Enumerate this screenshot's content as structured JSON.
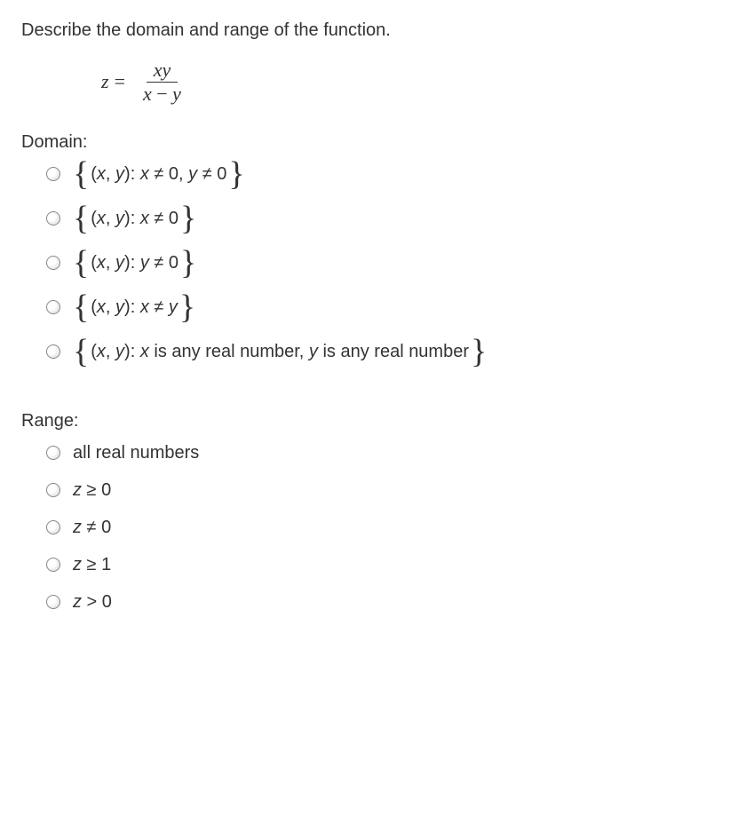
{
  "question": "Describe the domain and range of the function.",
  "equation": {
    "lhs_var": "z",
    "numerator": "xy",
    "denominator_left": "x",
    "denominator_right": "y"
  },
  "sections": {
    "domain_label": "Domain:",
    "range_label": "Range:"
  },
  "domain_options": [
    {
      "body_html": "(<span class='mathvar'>x</span>, <span class='mathvar'>y</span>): <span class='mathvar'>x</span> ≠ 0, <span class='mathvar'>y</span> ≠ 0"
    },
    {
      "body_html": "(<span class='mathvar'>x</span>, <span class='mathvar'>y</span>): <span class='mathvar'>x</span> ≠ 0"
    },
    {
      "body_html": "(<span class='mathvar'>x</span>, <span class='mathvar'>y</span>): <span class='mathvar'>y</span> ≠ 0"
    },
    {
      "body_html": "(<span class='mathvar'>x</span>, <span class='mathvar'>y</span>): <span class='mathvar'>x</span> ≠ <span class='mathvar'>y</span>"
    },
    {
      "body_html": "(<span class='mathvar'>x</span>, <span class='mathvar'>y</span>): <span class='mathvar'>x</span> is any real number, <span class='mathvar'>y</span> is any real number"
    }
  ],
  "range_options": [
    {
      "text_html": "all real numbers"
    },
    {
      "text_html": "<span class='mathvar'>z</span> ≥ 0"
    },
    {
      "text_html": "<span class='mathvar'>z</span> ≠ 0"
    },
    {
      "text_html": "<span class='mathvar'>z</span> ≥ 1"
    },
    {
      "text_html": "<span class='mathvar'>z</span> > 0"
    }
  ]
}
